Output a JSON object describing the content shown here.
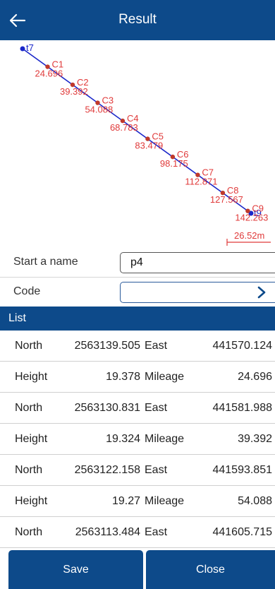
{
  "header": {
    "title": "Result"
  },
  "plot": {
    "start_label": "t7",
    "end_label": "t9",
    "points": [
      {
        "name": "C1",
        "mileage": "24.696"
      },
      {
        "name": "C2",
        "mileage": "39.392"
      },
      {
        "name": "C3",
        "mileage": "54.088"
      },
      {
        "name": "C4",
        "mileage": "68.783"
      },
      {
        "name": "C5",
        "mileage": "83.479"
      },
      {
        "name": "C6",
        "mileage": "98.175"
      },
      {
        "name": "C7",
        "mileage": "112.871"
      },
      {
        "name": "C8",
        "mileage": "127.567"
      },
      {
        "name": "C9",
        "mileage": "142.263"
      }
    ],
    "scale_label": "26.52m",
    "line_color": "#1a27c9",
    "point_color": "#c0392b"
  },
  "form": {
    "name_label": "Start a name",
    "name_value": "p4",
    "code_label": "Code",
    "code_value": ""
  },
  "list": {
    "title": "List",
    "rows": [
      {
        "k1": "North",
        "v1": "2563139.505",
        "k2": "East",
        "v2": "441570.124"
      },
      {
        "k1": "Height",
        "v1": "19.378",
        "k2": "Mileage",
        "v2": "24.696"
      },
      {
        "k1": "North",
        "v1": "2563130.831",
        "k2": "East",
        "v2": "441581.988"
      },
      {
        "k1": "Height",
        "v1": "19.324",
        "k2": "Mileage",
        "v2": "39.392"
      },
      {
        "k1": "North",
        "v1": "2563122.158",
        "k2": "East",
        "v2": "441593.851"
      },
      {
        "k1": "Height",
        "v1": "19.27",
        "k2": "Mileage",
        "v2": "54.088"
      },
      {
        "k1": "North",
        "v1": "2563113.484",
        "k2": "East",
        "v2": "441605.715"
      }
    ]
  },
  "footer": {
    "save_label": "Save",
    "close_label": "Close"
  },
  "colors": {
    "accent": "#0d4a8a",
    "label_red": "#e03a3a"
  }
}
